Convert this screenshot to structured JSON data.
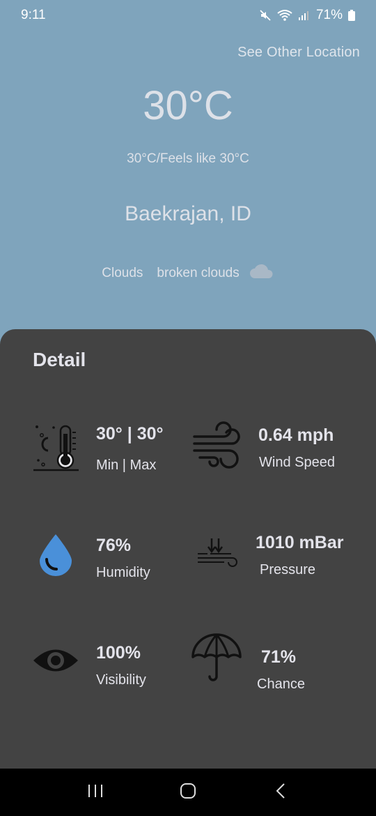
{
  "status_bar": {
    "time": "9:11",
    "battery": "71%"
  },
  "header": {
    "see_other_location": "See Other Location"
  },
  "current": {
    "temperature": "30°C",
    "feels_like": "30°C/Feels like 30°C",
    "location": "Baekrajan, ID",
    "condition_main": "Clouds",
    "condition_desc": "broken clouds",
    "condition_icon": "cloud-icon"
  },
  "detail": {
    "title": "Detail",
    "min_max": {
      "value": "30° | 30°",
      "label": "Min | Max",
      "icon": "thermometer-icon"
    },
    "wind": {
      "value": "0.64 mph",
      "label": "Wind Speed",
      "icon": "wind-icon"
    },
    "humidity": {
      "value": "76%",
      "label": "Humidity",
      "icon": "water-drop-icon"
    },
    "pressure": {
      "value": "1010 mBar",
      "label": "Pressure",
      "icon": "pressure-icon"
    },
    "visibility": {
      "value": "100%",
      "label": "Visibility",
      "icon": "eye-icon"
    },
    "chance": {
      "value": "71%",
      "label": "Chance",
      "icon": "umbrella-icon"
    }
  },
  "colors": {
    "background": "#7fa4bc",
    "panel": "#434343",
    "humidity_accent": "#4a90d9"
  }
}
